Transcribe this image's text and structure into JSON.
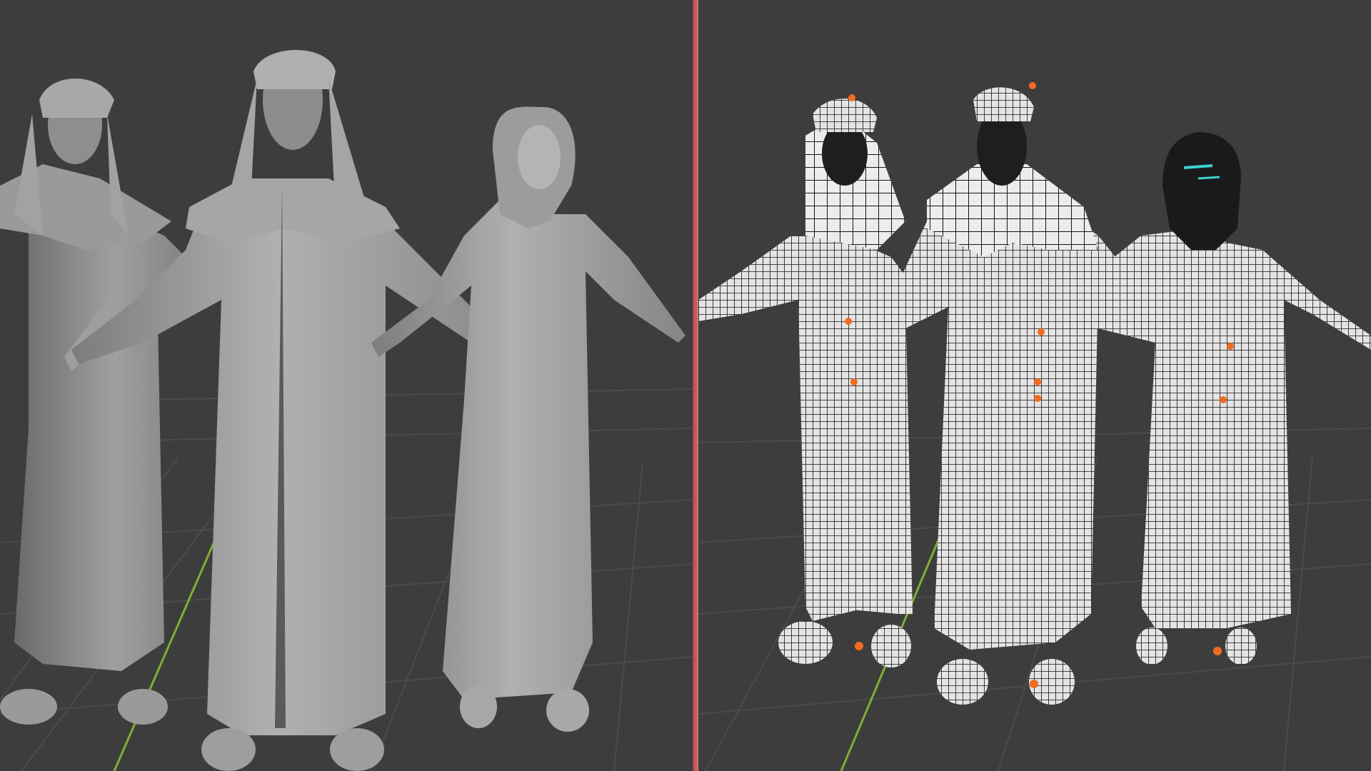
{
  "screen": {
    "description_free": true
  },
  "viewports": [
    {
      "mode": "solid",
      "colors": {
        "background": "#3d3d3d",
        "grid": "#4a4a4a",
        "y_axis": "#7fae34",
        "mesh": "#9a9a9a"
      }
    },
    {
      "mode": "wireframe",
      "colors": {
        "background": "#3d3d3d",
        "grid": "#4a4a4a",
        "y_axis": "#7fae34",
        "mesh": "#e6e6e6",
        "wire": "#111111",
        "origin": "#f26b21"
      }
    }
  ],
  "divider": {
    "color": "#c55a5a"
  }
}
